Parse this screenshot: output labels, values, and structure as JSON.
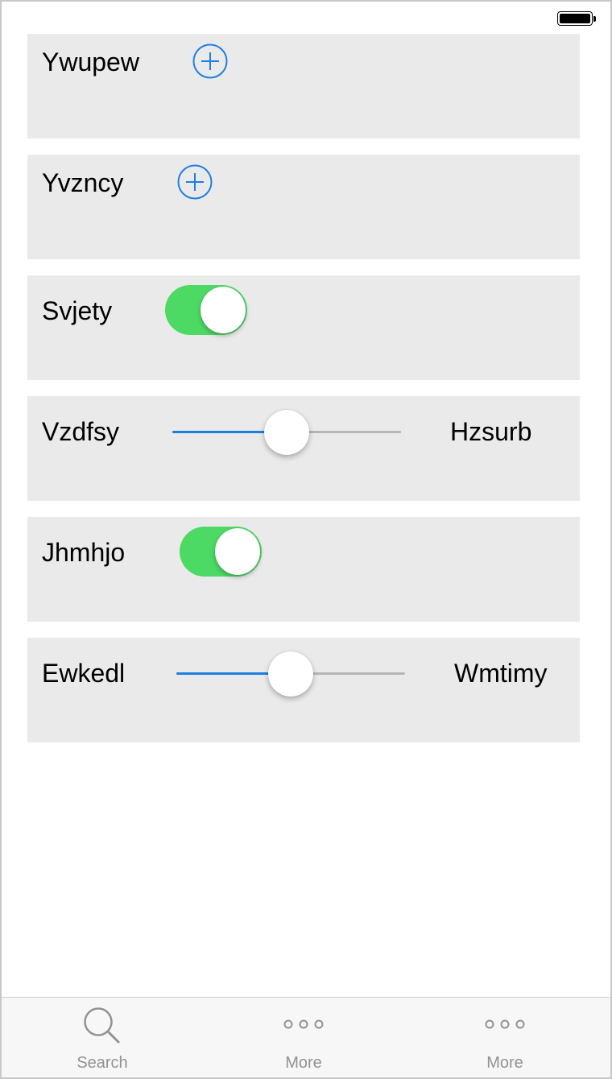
{
  "rows": [
    {
      "label": "Ywupew",
      "control": "add-button"
    },
    {
      "label": "Yvzncy",
      "control": "add-button"
    },
    {
      "label": "Svjety",
      "control": "toggle",
      "on": true
    },
    {
      "label": "Vzdfsy",
      "control": "slider",
      "value": 0.5,
      "right_label": "Hzsurb"
    },
    {
      "label": "Jhmhjo",
      "control": "toggle",
      "on": true
    },
    {
      "label": "Ewkedl",
      "control": "slider",
      "value": 0.5,
      "right_label": "Wmtimy"
    }
  ],
  "tabs": [
    {
      "label": "Search",
      "icon": "search-icon"
    },
    {
      "label": "More",
      "icon": "more-icon"
    },
    {
      "label": "More",
      "icon": "more-icon"
    }
  ],
  "colors": {
    "accent": "#1e7ee4",
    "toggle_on": "#4cd964",
    "row_background": "#eaeaea",
    "tab_label": "#929292"
  }
}
